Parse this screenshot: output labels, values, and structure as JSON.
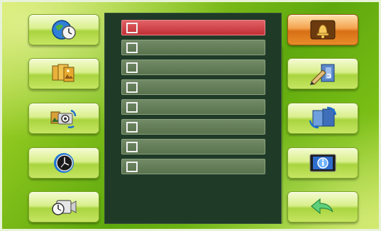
{
  "colors": {
    "background": "#7bbf16",
    "panel": "#203a28",
    "row": "#647d59",
    "row_selected": "#d0444a",
    "checkbox_border": "#f1f1f1",
    "button_active": "#e88c2a"
  },
  "left_buttons": [
    {
      "icon": "globe-clock-icon"
    },
    {
      "icon": "photo-stack-icon"
    },
    {
      "icon": "camera-sync-icon"
    },
    {
      "icon": "clock-dial-icon"
    },
    {
      "icon": "video-camera-icon"
    }
  ],
  "right_buttons": [
    {
      "icon": "bell-icon",
      "active": true
    },
    {
      "icon": "pen-3d-icon",
      "active": false
    },
    {
      "icon": "2d-3d-switch-icon",
      "active": false
    },
    {
      "icon": "info-screen-icon",
      "active": false
    },
    {
      "icon": "back-arrow-icon",
      "active": false
    }
  ],
  "list": {
    "rows": [
      {
        "checked": false,
        "selected": true
      },
      {
        "checked": false,
        "selected": false
      },
      {
        "checked": false,
        "selected": false
      },
      {
        "checked": false,
        "selected": false
      },
      {
        "checked": false,
        "selected": false
      },
      {
        "checked": false,
        "selected": false
      },
      {
        "checked": false,
        "selected": false
      },
      {
        "checked": false,
        "selected": false
      }
    ]
  }
}
